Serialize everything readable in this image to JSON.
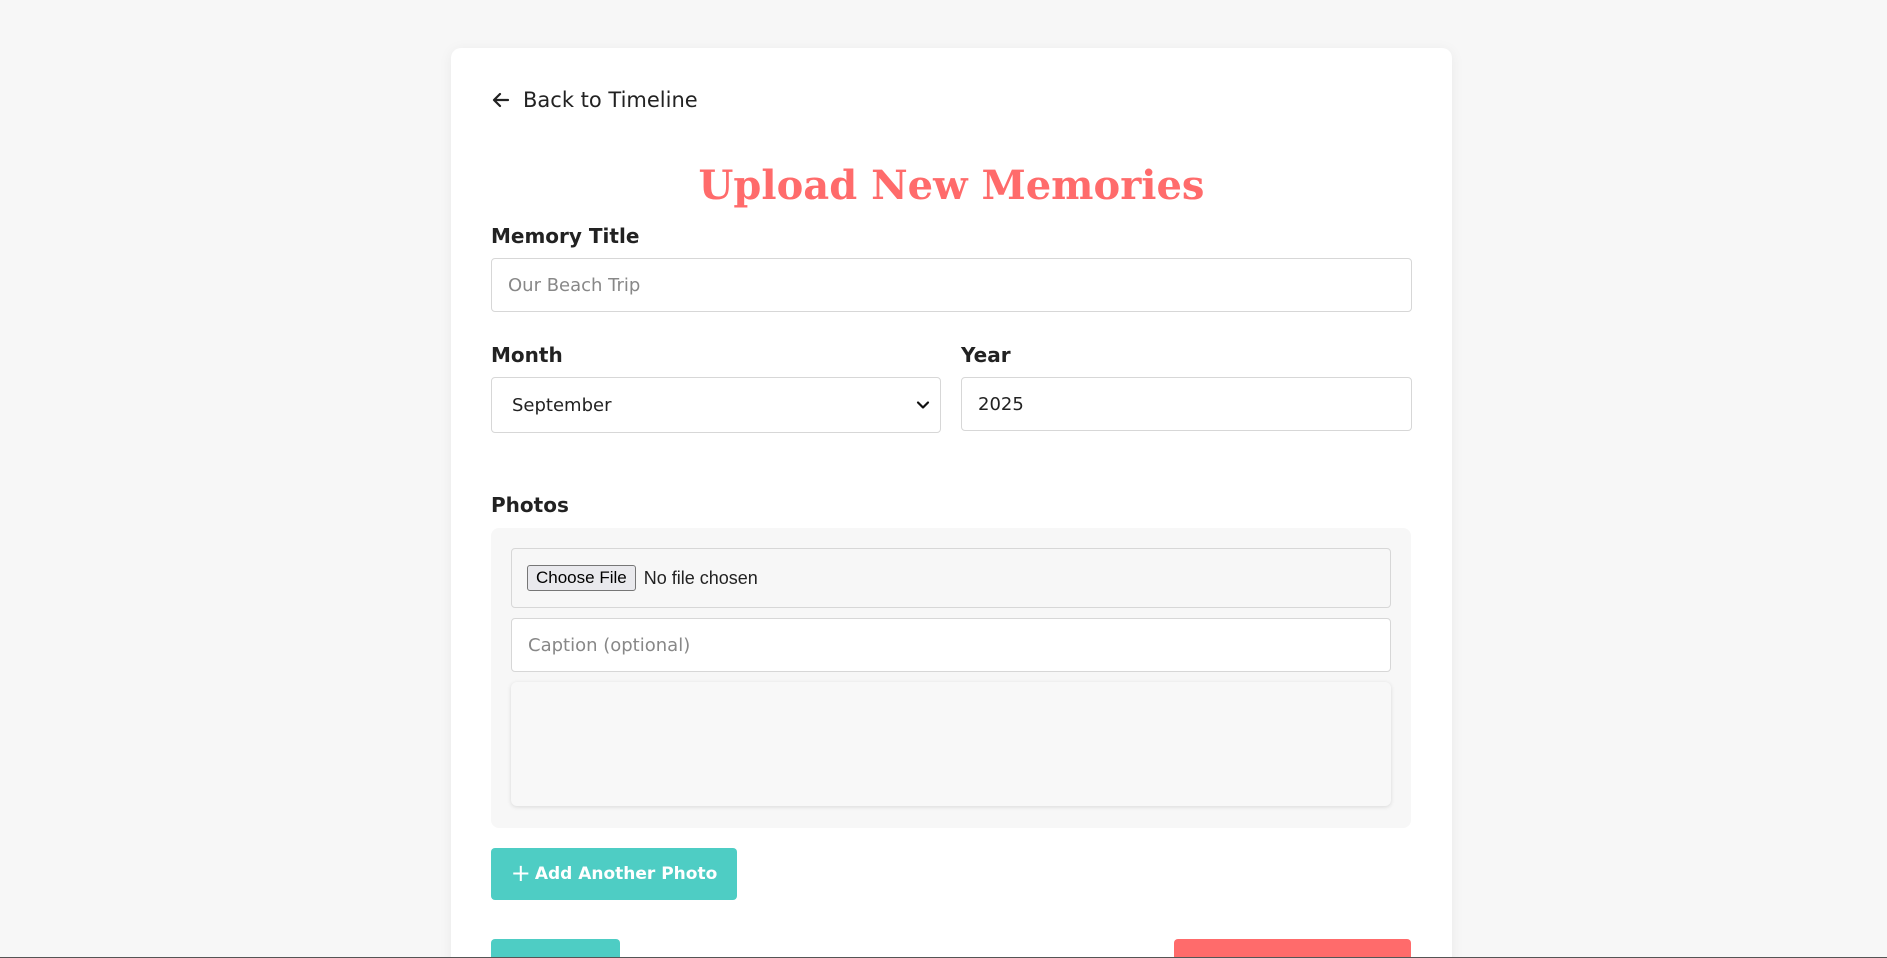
{
  "back_link": {
    "label": "Back to Timeline",
    "icon": "arrow-left-icon"
  },
  "page_title": "Upload New Memories",
  "memory_title": {
    "label": "Memory Title",
    "placeholder": "Our Beach Trip",
    "value": ""
  },
  "month": {
    "label": "Month",
    "selected": "September"
  },
  "year": {
    "label": "Year",
    "value": "2025"
  },
  "photos": {
    "label": "Photos",
    "file_button_label": "Choose File",
    "file_status": "No file chosen",
    "caption_placeholder": "Caption (optional)"
  },
  "add_photo_button": {
    "label": "Add Another Photo",
    "icon": "plus-icon"
  },
  "colors": {
    "accent_coral": "#ff6b6b",
    "accent_teal": "#4ecdc4",
    "background": "#f7f7f7"
  }
}
